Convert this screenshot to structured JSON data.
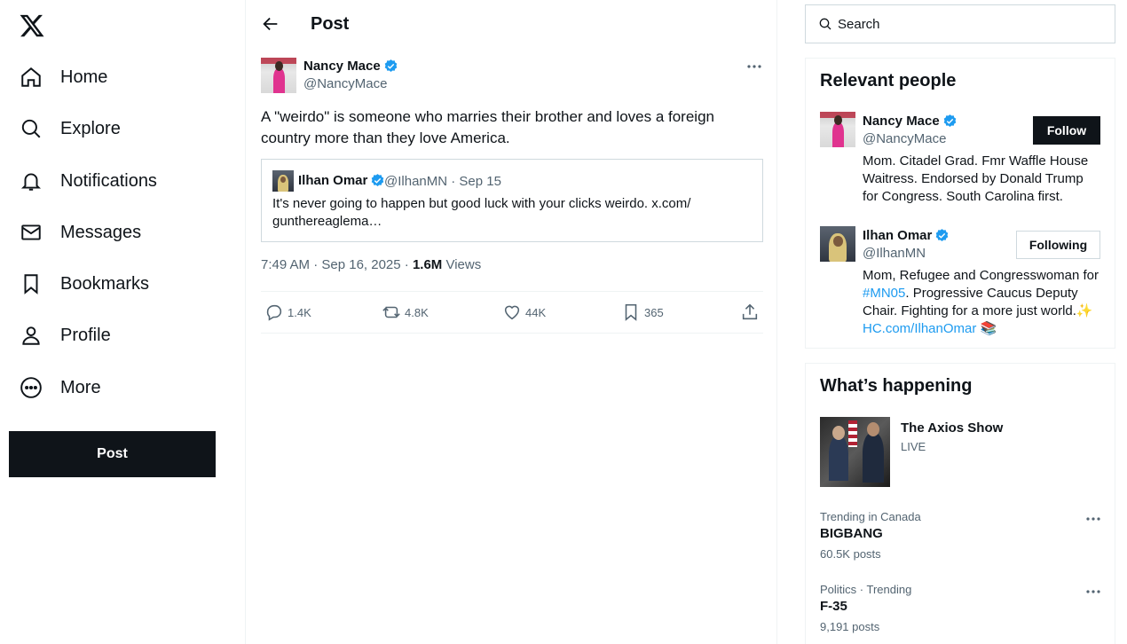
{
  "nav": {
    "items": [
      {
        "label": "Home",
        "icon": "home-icon"
      },
      {
        "label": "Explore",
        "icon": "search-icon"
      },
      {
        "label": "Notifications",
        "icon": "bell-icon"
      },
      {
        "label": "Messages",
        "icon": "envelope-icon"
      },
      {
        "label": "Bookmarks",
        "icon": "bookmark-icon"
      },
      {
        "label": "Profile",
        "icon": "person-icon"
      },
      {
        "label": "More",
        "icon": "more-circle-icon"
      }
    ],
    "post_button": "Post"
  },
  "header": {
    "title": "Post"
  },
  "tweet": {
    "author_name": "Nancy Mace",
    "author_handle": "@NancyMace",
    "text": "A \"weirdo\" is someone who marries their brother and loves a foreign country more than they love America.",
    "quote": {
      "author_name": "Ilhan Omar",
      "author_handle": "@IlhanMN · Sep 15",
      "text": "It's never going to happen but good luck with your clicks weirdo. x.com/ gunthereaglema…"
    },
    "time": "7:49 AM · Sep 16, 2025 · ",
    "views_count": "1.6M",
    "views_label": " Views",
    "replies": "1.4K",
    "reposts": "4.8K",
    "likes": "44K",
    "bookmarks": "365"
  },
  "search": {
    "placeholder": "Search"
  },
  "relevant_people": {
    "title": "Relevant people",
    "people": [
      {
        "name": "Nancy Mace",
        "handle": "@NancyMace",
        "bio": "Mom. Citadel Grad. Fmr Waffle House Waitress. Endorsed by Donald Trump for Congress. South Carolina first.",
        "button": "Follow"
      },
      {
        "name": "Ilhan Omar",
        "handle": "@IlhanMN",
        "bio_part1": "Mom, Refugee and Congresswoman for ",
        "bio_hashtag": "#MN05",
        "bio_part2": ". Progressive Caucus Deputy Chair. Fighting for a more just world.✨ ",
        "bio_link": "HC.com/IlhanOmar",
        "bio_emoji": "📚",
        "button": "Following"
      }
    ]
  },
  "happening": {
    "title": "What’s happening",
    "live": {
      "title": "The Axios Show",
      "status": "LIVE"
    },
    "trends": [
      {
        "meta": "Trending in Canada",
        "name": "BIGBANG",
        "count": "60.5K posts"
      },
      {
        "meta": "Politics · Trending",
        "name": "F-35",
        "count": "9,191 posts"
      }
    ]
  },
  "colors": {
    "accent": "#1d9bf0",
    "text": "#0f1419",
    "muted": "#536471",
    "border": "#eff3f4"
  }
}
